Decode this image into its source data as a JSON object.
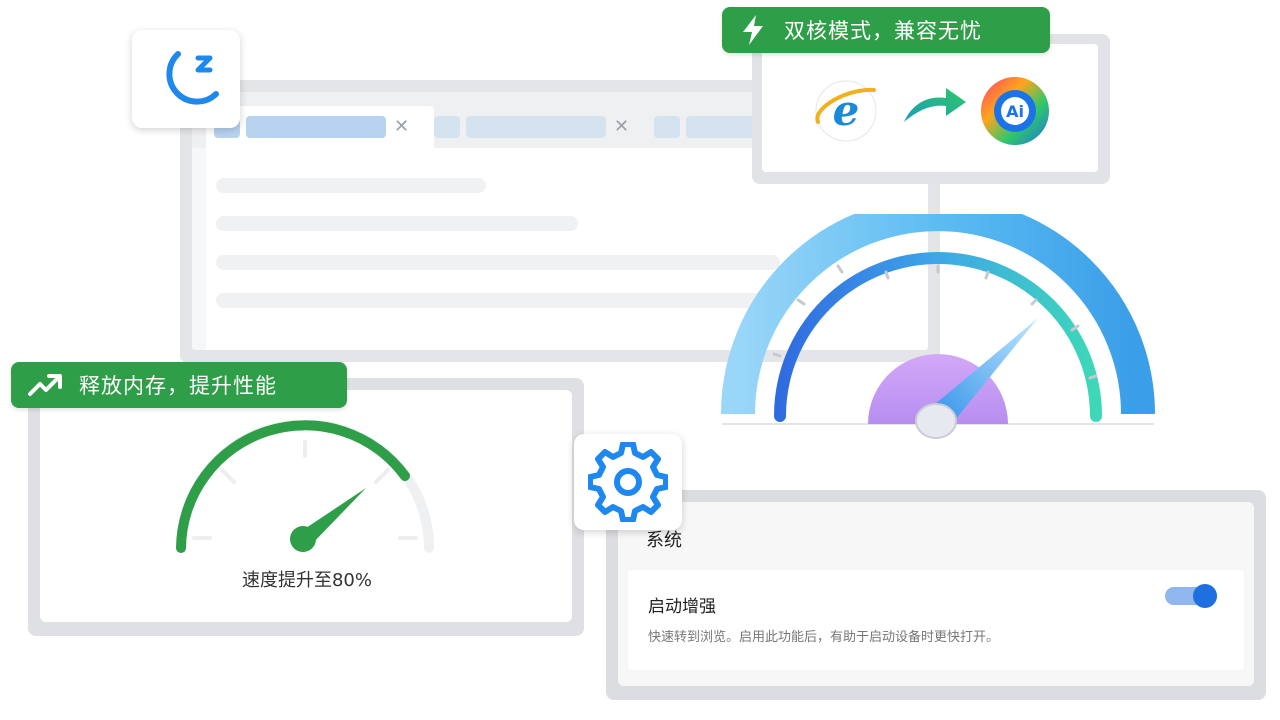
{
  "badges": {
    "dual_core": "双核模式，兼容无忧",
    "memory": "释放内存，提升性能"
  },
  "speed_card": {
    "text": "速度提升至80%",
    "level_percent": 80
  },
  "boost_gauge": {
    "level_percent": 80
  },
  "settings": {
    "section_title": "系统",
    "option_title": "启动增强",
    "option_desc": "快速转到浏览。启用此功能后，有助于启动设备时更快打开。",
    "toggle_on": true
  },
  "logos": {
    "ai_browser": "Ai",
    "ie": "e"
  },
  "icons": {
    "sleep": "moon-zz-icon",
    "settings": "gear-icon",
    "lightning": "lightning-icon",
    "trend": "trend-up-icon",
    "arrow": "arrow-right-icon"
  },
  "colors": {
    "badge_green": "#2f9e48",
    "accent_blue": "#1f6fe0",
    "icon_blue": "#1e88ee"
  }
}
